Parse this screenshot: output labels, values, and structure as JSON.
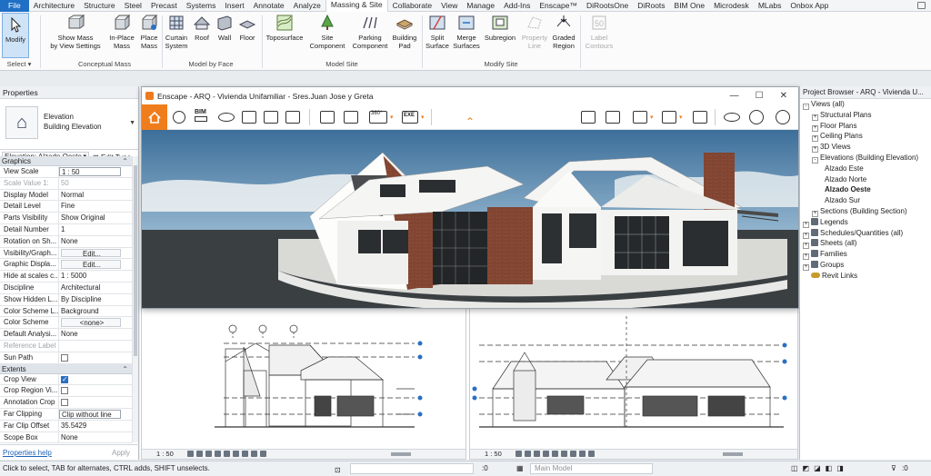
{
  "ribbon_tabs": [
    "File",
    "Architecture",
    "Structure",
    "Steel",
    "Precast",
    "Systems",
    "Insert",
    "Annotate",
    "Analyze",
    "Massing & Site",
    "Collaborate",
    "View",
    "Manage",
    "Add-Ins",
    "Enscape™",
    "DiRootsOne",
    "DiRoots",
    "BIM One",
    "Microdesk",
    "MLabs",
    "Onbox App"
  ],
  "ribbon": {
    "modify": "Modify",
    "select": "Select ▾",
    "show_mass_1": "Show Mass",
    "show_mass_2": "by View Settings",
    "inplace_1": "In-Place",
    "inplace_2": "Mass",
    "place_1": "Place",
    "place_2": "Mass",
    "conceptual_mass": "Conceptual Mass",
    "curtain_1": "Curtain",
    "curtain_2": "System",
    "roof": "Roof",
    "wall": "Wall",
    "floor": "Floor",
    "model_by_face": "Model by Face",
    "toposurface": "Toposurface",
    "site_comp_1": "Site",
    "site_comp_2": "Component",
    "parking_1": "Parking",
    "parking_2": "Component",
    "building_pad_1": "Building",
    "building_pad_2": "Pad",
    "model_site": "Model Site",
    "split_1": "Split",
    "split_2": "Surface",
    "merge_1": "Merge",
    "merge_2": "Surfaces",
    "subregion": "Subregion",
    "property_line_1": "Property",
    "property_line_2": "Line",
    "graded_1": "Graded",
    "graded_2": "Region",
    "modify_site": "Modify Site",
    "label_contours_1": "Label",
    "label_contours_2": "Contours"
  },
  "properties": {
    "title": "Properties",
    "type_line1": "Elevation",
    "type_line2": "Building Elevation",
    "filter": "Elevation: Alzado Oeste",
    "edit_type": "Edit Type",
    "sections": {
      "graphics": "Graphics",
      "extents": "Extents"
    },
    "rows_graphics": [
      {
        "k": "View Scale",
        "v": "1 : 50"
      },
      {
        "k": "Scale Value    1:",
        "v": "50"
      },
      {
        "k": "Display Model",
        "v": "Normal"
      },
      {
        "k": "Detail Level",
        "v": "Fine"
      },
      {
        "k": "Parts Visibility",
        "v": "Show Original"
      },
      {
        "k": "Detail Number",
        "v": "1"
      },
      {
        "k": "Rotation on Sh...",
        "v": "None"
      },
      {
        "k": "Visibility/Graph...",
        "v": "Edit..."
      },
      {
        "k": "Graphic Displa...",
        "v": "Edit..."
      },
      {
        "k": "Hide at scales c...",
        "v": "1 : 5000"
      },
      {
        "k": "Discipline",
        "v": "Architectural"
      },
      {
        "k": "Show Hidden L...",
        "v": "By Discipline"
      },
      {
        "k": "Color Scheme L...",
        "v": "Background"
      },
      {
        "k": "Color Scheme",
        "v": "<none>"
      },
      {
        "k": "Default Analysi...",
        "v": "None"
      },
      {
        "k": "Reference Label",
        "v": ""
      },
      {
        "k": "Sun Path",
        "v": ""
      }
    ],
    "rows_extents": [
      {
        "k": "Crop View",
        "v": ""
      },
      {
        "k": "Crop Region Vi...",
        "v": ""
      },
      {
        "k": "Annotation Crop",
        "v": ""
      },
      {
        "k": "Far Clipping",
        "v": "Clip without line"
      },
      {
        "k": "Far Clip Offset",
        "v": "35.5429"
      },
      {
        "k": "Scope Box",
        "v": "None"
      }
    ],
    "help": "Properties help",
    "apply": "Apply"
  },
  "enscape": {
    "title": "Enscape - ARQ - Vivienda Unifamiliar - Sres.Juan Jose y Greta",
    "bim_label": "BIM",
    "exe_label": "EXE",
    "pano_label": "360°"
  },
  "view_tiles": {
    "left_scale": "1 : 50",
    "right_scale": "1 : 50"
  },
  "browser": {
    "title": "Project Browser - ARQ - Vivienda U...",
    "items": [
      {
        "label": "Views (all)",
        "level": 0,
        "exp": "-"
      },
      {
        "label": "Structural Plans",
        "level": 1,
        "exp": "+"
      },
      {
        "label": "Floor Plans",
        "level": 1,
        "exp": "+"
      },
      {
        "label": "Ceiling Plans",
        "level": 1,
        "exp": "+"
      },
      {
        "label": "3D Views",
        "level": 1,
        "exp": "+"
      },
      {
        "label": "Elevations (Building Elevation)",
        "level": 1,
        "exp": "-"
      },
      {
        "label": "Alzado Este",
        "level": 2,
        "exp": ""
      },
      {
        "label": "Alzado Norte",
        "level": 2,
        "exp": ""
      },
      {
        "label": "Alzado Oeste",
        "level": 2,
        "exp": "",
        "selected": true
      },
      {
        "label": "Alzado Sur",
        "level": 2,
        "exp": ""
      },
      {
        "label": "Sections (Building Section)",
        "level": 1,
        "exp": "+"
      },
      {
        "label": "Legends",
        "level": 0,
        "exp": "+"
      },
      {
        "label": "Schedules/Quantities (all)",
        "level": 0,
        "exp": "+"
      },
      {
        "label": "Sheets (all)",
        "level": 0,
        "exp": "+"
      },
      {
        "label": "Families",
        "level": 0,
        "exp": "+"
      },
      {
        "label": "Groups",
        "level": 0,
        "exp": "+"
      },
      {
        "label": "Revit Links",
        "level": 0,
        "exp": ""
      }
    ]
  },
  "status": {
    "message": "Click to select, TAB for alternates, CTRL adds, SHIFT unselects.",
    "zero1": ":0",
    "main_model": "Main Model",
    "filter_count": ":0"
  },
  "colors": {
    "file_tab": "#1f6fc5",
    "enscape_orange": "#f07d1c",
    "selection": "#cfe3f7"
  }
}
